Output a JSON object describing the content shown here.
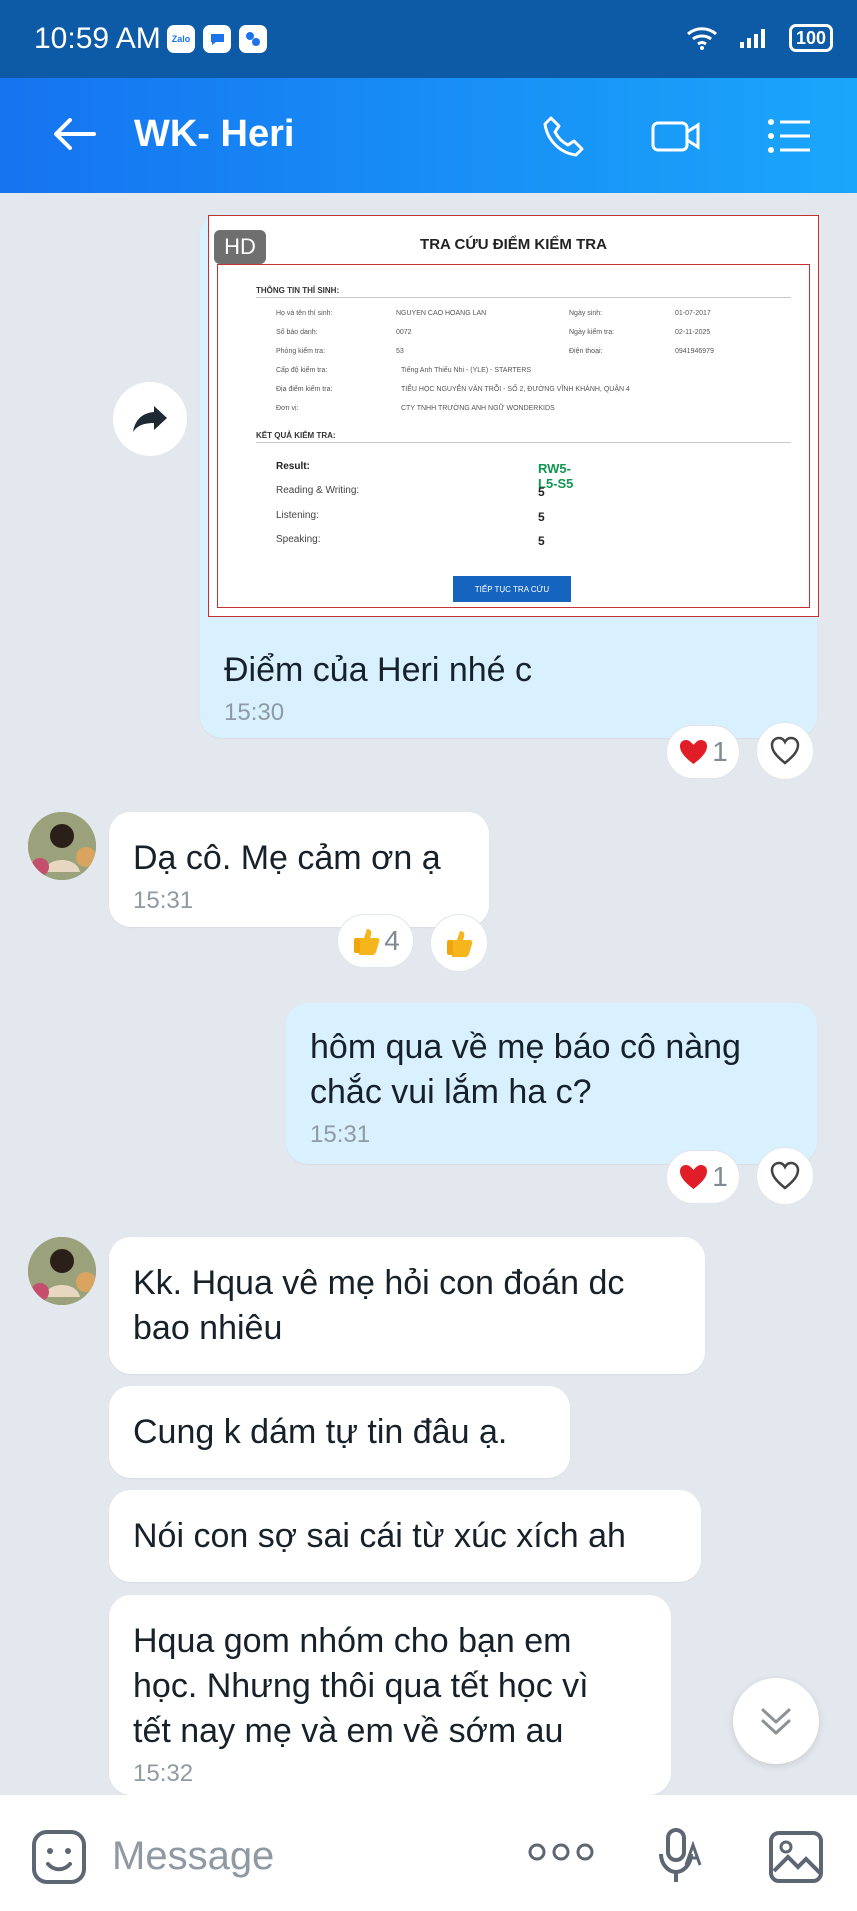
{
  "status_bar": {
    "time": "10:59 AM",
    "apps": [
      "Zalo",
      "chat",
      "bubble"
    ],
    "battery": "100"
  },
  "header": {
    "title": "WK- Heri",
    "icons": [
      "back-arrow-icon",
      "phone-icon",
      "video-call-icon",
      "menu-icon"
    ]
  },
  "chat": {
    "messages": [
      {
        "direction": "outgoing",
        "has_image": true,
        "image_badge": "HD",
        "text": "Điểm của Heri nhé c",
        "time": "15:30",
        "reaction": {
          "emoji": "heart",
          "count": "1"
        }
      },
      {
        "direction": "incoming",
        "text": "Dạ cô. Mẹ cảm ơn ạ",
        "time": "15:31",
        "reaction": {
          "emoji": "thumbs-up",
          "count": "4"
        }
      },
      {
        "direction": "outgoing",
        "text": "hôm qua về mẹ báo cô nàng\nchắc vui lắm ha c?",
        "time": "15:31",
        "reaction": {
          "emoji": "heart",
          "count": "1"
        }
      },
      {
        "direction": "incoming",
        "text": "Kk. Hqua vê mẹ hỏi con đoán dc\nbao nhiêu"
      },
      {
        "direction": "incoming",
        "text": "Cung k dám tự tin đâu ạ."
      },
      {
        "direction": "incoming",
        "text": "Nói con sợ sai cái từ xúc xích ah"
      },
      {
        "direction": "incoming",
        "text": "Hqua gom nhóm cho bạn em\nhọc. Nhưng thôi qua tết học vì\ntết nay mẹ và em về sớm au",
        "time": "15:32"
      }
    ]
  },
  "shared_image": {
    "title": "TRA CỨU ĐIỂM KIỂM TRA",
    "candidate_section": "THÔNG TIN THÍ SINH:",
    "candidate_rows": [
      {
        "label": "Họ và tên thí sinh:",
        "value": "NGUYEN CAO HOANG LAN",
        "label2": "Ngày sinh:",
        "value2": "01-07-2017"
      },
      {
        "label": "Số báo danh:",
        "value": "0072",
        "label2": "Ngày kiểm tra:",
        "value2": "02-11-2025"
      },
      {
        "label": "Phòng kiểm tra:",
        "value": "53",
        "label2": "Điện thoại:",
        "value2": "0941946979"
      },
      {
        "label": "Cấp độ kiểm tra:",
        "value": "Tiếng Anh Thiếu Nhi - (YLE) - STARTERS"
      },
      {
        "label": "Địa điểm kiểm tra:",
        "value": "TIỂU HỌC NGUYỄN VĂN TRỖI - SỐ 2, ĐƯỜNG VĨNH KHÁNH, QUẬN 4"
      },
      {
        "label": "Đơn vị:",
        "value": "CTY TNHH TRƯỜNG ANH NGỮ WONDERKIDS"
      }
    ],
    "result_section": "KẾT QUẢ KIỂM TRA:",
    "results": [
      {
        "label": "Result:",
        "value": "RW5-L5-S5"
      },
      {
        "label": "Reading & Writing:",
        "value": "5"
      },
      {
        "label": "Listening:",
        "value": "5"
      },
      {
        "label": "Speaking:",
        "value": "5"
      }
    ],
    "button": "TIẾP TỤC TRA CỨU"
  },
  "composer": {
    "placeholder": "Message",
    "icons": [
      "emoji-icon",
      "more-icon",
      "voice-input-icon",
      "image-icon"
    ]
  }
}
